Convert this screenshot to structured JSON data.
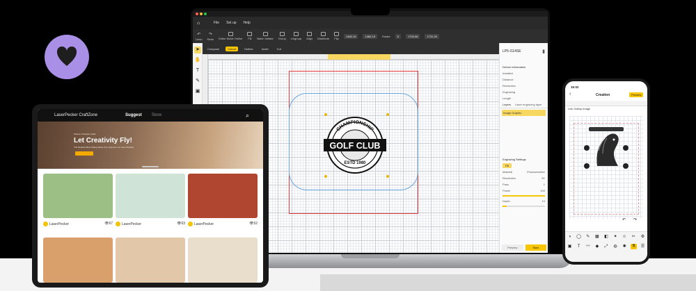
{
  "colors": {
    "accent": "#f7c600",
    "brand": "#a98fe6",
    "selection": "#e03a3a",
    "guide": "#6aa7e0"
  },
  "brand": {
    "icon": "heart-icon"
  },
  "laptop": {
    "menu": [
      "File",
      "Set up",
      "Help"
    ],
    "toolbar": [
      {
        "label": "Undo",
        "icon": "undo-icon"
      },
      {
        "label": "Redo",
        "icon": "redo-icon"
      },
      {
        "label": "Editor Mode Online",
        "icon": "editor-icon"
      },
      {
        "label": "Fill",
        "icon": "fill-icon"
      },
      {
        "label": "Batch Imitate",
        "icon": "batch-icon"
      },
      {
        "label": "Group",
        "icon": "group-icon"
      },
      {
        "label": "Ungroup",
        "icon": "ungroup-icon"
      },
      {
        "label": "Align",
        "icon": "align-icon"
      },
      {
        "label": "Distribute",
        "icon": "distribute-icon"
      },
      {
        "label": "Flip",
        "icon": "flip-icon"
      }
    ],
    "fields": {
      "width": "1460.19",
      "height": "1460.19",
      "rotate": "Rotate",
      "rotate_value": "0",
      "pos_x": "1733.06",
      "pos_y": "1731.20"
    },
    "subtabs": [
      "Compose",
      "Cutout",
      "Outline",
      "Invert",
      "Cut"
    ],
    "selected_subtab": 1,
    "device": {
      "name": "LP5-I114SE",
      "info_title": "Device information",
      "rows": [
        "Installed",
        "Distance",
        "Resolution",
        "Engraving",
        "Length"
      ],
      "layers_tab": "Layers",
      "layer_name": "Laser engraving layer",
      "layer_item": "Image Graphic"
    },
    "engraving": {
      "title": "Engraving Settings",
      "mode": "Fill",
      "material_label": "Material",
      "material_value": "Photosensitive",
      "resolution_label": "Resolution",
      "resolution_value": "2K",
      "pass_label": "Pass",
      "pass_value": "1",
      "power_label": "Power",
      "power_value": "100",
      "depth_label": "Depth",
      "depth_value": "10",
      "power_fill": 1.0,
      "depth_fill": 0.1
    },
    "preview_btn": "Preview",
    "start_btn": "Start",
    "logo": {
      "top": "CHAMPIONSHIP",
      "main": "GOLF CLUB",
      "bottom": "ESTD 1980"
    }
  },
  "tablet": {
    "brand": "LaserPecker CraftZone",
    "tabs": [
      "Suggest",
      "Store"
    ],
    "selected_tab": 0,
    "hero": {
      "small": "Stories of Simple Crafts",
      "title": "Let Creativity Fly!",
      "sub": "The Realistic Best Selling Ideas from Engraver for Laser Marking"
    },
    "cards": [
      {
        "author": "LaserPecker",
        "views": "67",
        "color": "#9bbf84"
      },
      {
        "author": "LaserPecker",
        "views": "63",
        "color": "#cfe3d6"
      },
      {
        "author": "LaserPecker",
        "views": "52",
        "color": "#b0462f"
      },
      {
        "author": "",
        "views": "",
        "color": "#d9a06b"
      },
      {
        "author": "",
        "views": "",
        "color": "#e2c7a8"
      },
      {
        "author": "",
        "views": "",
        "color": "#e9ddcc"
      }
    ]
  },
  "phone": {
    "time": "16:02",
    "title": "Creation",
    "action": "Preview",
    "layer_name": "Link Gallop Image",
    "bottom_row1": [
      "Shape",
      "Outline",
      "Edit",
      "Group",
      "Simp",
      "Trace",
      "Emo",
      "Cut",
      "Settings"
    ],
    "bottom_row2": [
      "Image",
      "Text",
      "Doodle",
      "Shapes",
      "Scale",
      "Stencil",
      "Lamp",
      "Lab",
      "Settings"
    ]
  }
}
